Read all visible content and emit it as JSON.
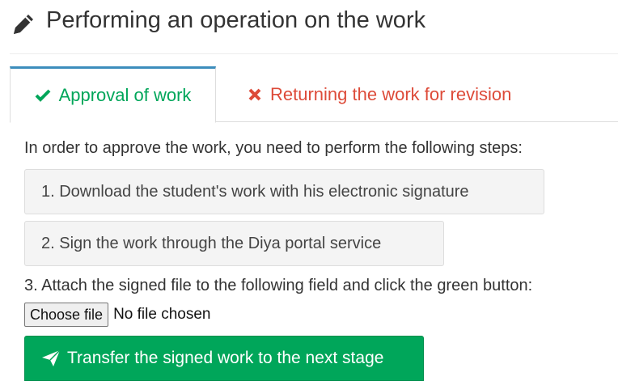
{
  "header": {
    "icon": "pencil-icon",
    "title": "Performing an operation on the work"
  },
  "tabs": [
    {
      "label": "Approval of work",
      "icon": "check-icon",
      "color": "#00a65a",
      "active": true
    },
    {
      "label": "Returning the work for revision",
      "icon": "close-icon",
      "color": "#dd4b39",
      "active": false
    }
  ],
  "approval": {
    "intro": "In order to approve the work, you need to perform the following steps:",
    "step1_button": "1. Download the student's work with his electronic signature",
    "step2_button": "2. Sign the work through the Diya portal service",
    "step3_text": "3. Attach the signed file to the following field and click the green button:",
    "file_input": {
      "button_label": "Choose file",
      "status": "No file chosen"
    },
    "submit_button": {
      "label": "Transfer the signed work to the next stage",
      "icon": "send-icon",
      "color": "#00a65a"
    }
  }
}
